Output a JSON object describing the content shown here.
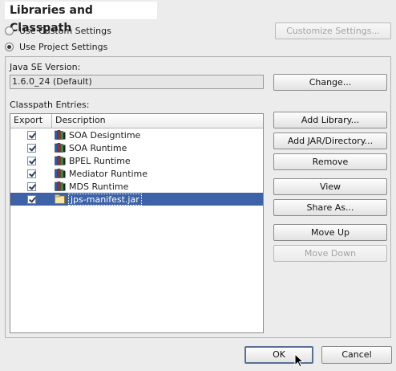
{
  "dialog": {
    "title": "Libraries and Classpath"
  },
  "settings": {
    "custom_label": "Use Custom Settings",
    "project_label": "Use Project Settings",
    "selected": "project",
    "customize_button": "Customize Settings..."
  },
  "java_se": {
    "label": "Java SE Version:",
    "value": "1.6.0_24 (Default)",
    "change_button": "Change..."
  },
  "classpath": {
    "label": "Classpath Entries:",
    "columns": {
      "export": "Export",
      "description": "Description"
    },
    "rows": [
      {
        "checked": true,
        "label": "SOA Designtime",
        "icon": "library-icon"
      },
      {
        "checked": true,
        "label": "SOA Runtime",
        "icon": "library-icon"
      },
      {
        "checked": true,
        "label": "BPEL Runtime",
        "icon": "library-icon"
      },
      {
        "checked": true,
        "label": "Mediator Runtime",
        "icon": "library-icon"
      },
      {
        "checked": true,
        "label": "MDS Runtime",
        "icon": "library-icon"
      },
      {
        "checked": true,
        "label": "jps-manifest.jar",
        "icon": "jar-file-icon",
        "selected": true
      }
    ]
  },
  "buttons": {
    "add_library": "Add Library...",
    "add_jar": "Add JAR/Directory...",
    "remove": "Remove",
    "view": "View",
    "share_as": "Share As...",
    "move_up": "Move Up",
    "move_down": "Move Down",
    "ok": "OK",
    "cancel": "Cancel"
  },
  "colors": {
    "selection": "#3d62a8",
    "panel_bg": "#ececec"
  }
}
